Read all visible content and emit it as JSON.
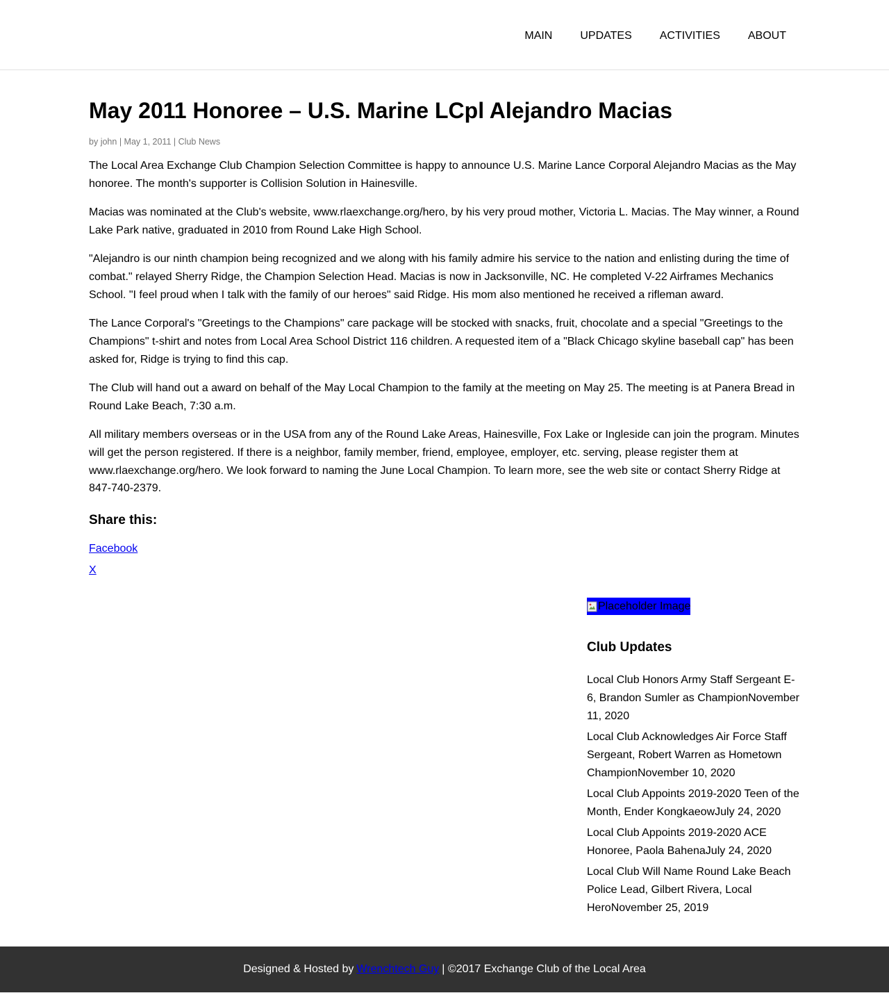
{
  "nav": {
    "items": [
      {
        "label": "MAIN"
      },
      {
        "label": "UPDATES"
      },
      {
        "label": "ACTIVITIES"
      },
      {
        "label": "ABOUT"
      }
    ]
  },
  "post": {
    "title": "May 2011 Honoree – U.S. Marine LCpl Alejandro Macias",
    "meta": {
      "prefix": "by",
      "author": "john",
      "date": "May 1, 2011",
      "category": "Club News",
      "separator": "|"
    },
    "paragraphs": [
      "The Local Area Exchange Club Champion Selection Committee is happy to announce U.S. Marine Lance Corporal Alejandro Macias as the May honoree. The month's supporter is Collision Solution in Hainesville.",
      "Macias was nominated at the Club's website, www.rlaexchange.org/hero, by his very proud mother, Victoria L. Macias. The May winner, a Round Lake Park native, graduated in 2010 from Round Lake High School.",
      "\"Alejandro is our ninth champion being recognized and we along with his family admire his service to the nation and enlisting during the time of combat.\" relayed Sherry Ridge, the Champion Selection Head. Macias is now in Jacksonville, NC. He completed V-22 Airframes Mechanics School. \"I feel proud when I talk with the family of our heroes\" said Ridge. His mom also mentioned he received a rifleman award.",
      "The Lance Corporal's \"Greetings to the Champions\" care package will be stocked with snacks, fruit, chocolate and a special \"Greetings to the Champions\" t-shirt and notes from Local Area School District 116 children. A requested item of a \"Black Chicago skyline baseball cap\" has been asked for, Ridge is trying to find this cap.",
      "The Club will hand out a award on behalf of the May Local Champion to the family at the meeting on May 25. The meeting is at Panera Bread in Round Lake Beach, 7:30 a.m.",
      "All military members overseas or in the USA from any of the Round Lake Areas, Hainesville, Fox Lake or Ingleside can join the program. Minutes will get the person registered. If there is a neighbor, family member, friend, employee, employer, etc. serving, please register them at www.rlaexchange.org/hero. We look forward to naming the June Local Champion. To learn more, see the web site or contact Sherry Ridge at 847-740-2379."
    ]
  },
  "share": {
    "heading": "Share this:",
    "links": [
      {
        "label": "Facebook"
      },
      {
        "label": "X"
      }
    ]
  },
  "sidebar": {
    "image_alt": "Placeholder Image",
    "widget_title": "Club Updates",
    "updates": [
      {
        "title": "Local Club Honors Army Staff Sergeant E-6, Brandon Sumler as Champion",
        "date": "November 11, 2020"
      },
      {
        "title": "Local Club Acknowledges Air Force Staff Sergeant, Robert Warren as Hometown Champion",
        "date": "November 10, 2020"
      },
      {
        "title": "Local Club Appoints 2019-2020 Teen of the Month, Ender Kongkaeow",
        "date": "July 24, 2020"
      },
      {
        "title": "Local Club Appoints 2019-2020 ACE Honoree, Paola Bahena",
        "date": "July 24, 2020"
      },
      {
        "title": "Local Club Will Name Round Lake Beach Police Lead, Gilbert Rivera, Local Hero",
        "date": "November 25, 2019"
      }
    ]
  },
  "footer": {
    "prefix": "Designed & Hosted by",
    "link_label": "Wrenchtech Guy",
    "suffix": "| ©2017 Exchange Club of the Local Area"
  },
  "colors": {
    "footer_bg": "#323232",
    "link": "#0000ee",
    "placeholder_bg": "#0000ff",
    "meta_text": "#777777"
  }
}
